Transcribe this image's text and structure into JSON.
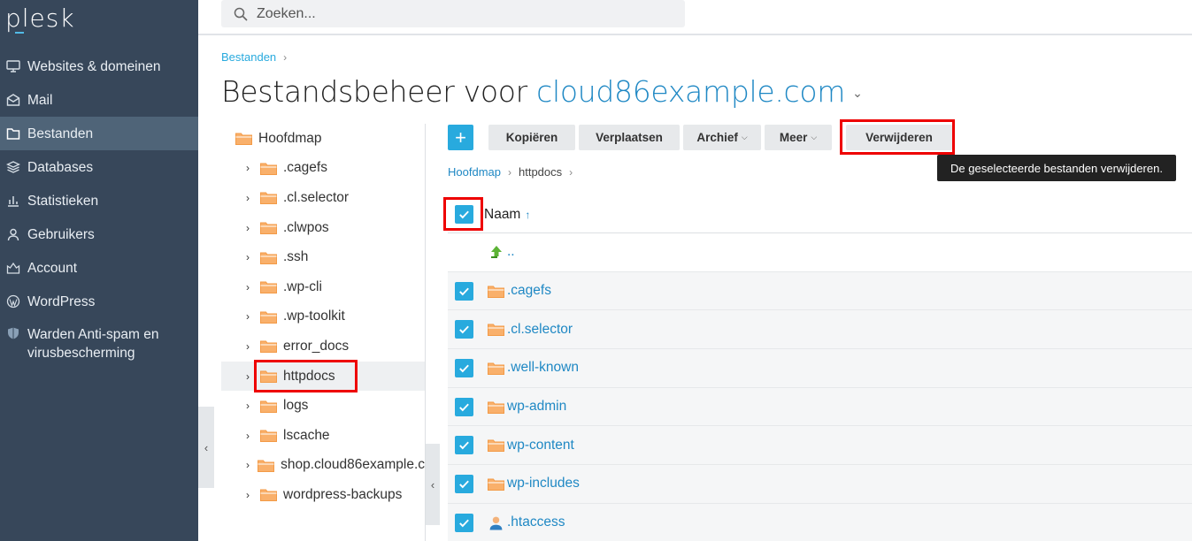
{
  "app": {
    "logo": "plesk"
  },
  "search": {
    "placeholder": "Zoeken..."
  },
  "sidebar": {
    "items": [
      {
        "label": "Websites & domeinen",
        "icon": "monitor-icon"
      },
      {
        "label": "Mail",
        "icon": "mail-icon"
      },
      {
        "label": "Bestanden",
        "icon": "files-icon",
        "active": true
      },
      {
        "label": "Databases",
        "icon": "database-icon"
      },
      {
        "label": "Statistieken",
        "icon": "statistics-icon"
      },
      {
        "label": "Gebruikers",
        "icon": "user-icon"
      },
      {
        "label": "Account",
        "icon": "account-icon"
      },
      {
        "label": "WordPress",
        "icon": "wordpress-icon"
      },
      {
        "label_line1": "Warden Anti-spam en",
        "label_line2": "virusbescherming",
        "icon": "shield-icon"
      }
    ]
  },
  "breadcrumb": {
    "root": "Bestanden"
  },
  "title": {
    "prefix": "Bestandsbeheer voor",
    "domain": "cloud86example.com"
  },
  "tree": {
    "root": "Hoofdmap",
    "children": [
      ".cagefs",
      ".cl.selector",
      ".clwpos",
      ".ssh",
      ".wp-cli",
      ".wp-toolkit",
      "error_docs",
      "httpdocs",
      "logs",
      "lscache",
      "shop.cloud86example.c",
      "wordpress-backups"
    ],
    "selected": "httpdocs"
  },
  "toolbar": {
    "add": "+",
    "copy": "Kopiëren",
    "move": "Verplaatsen",
    "archive": "Archief",
    "more": "Meer",
    "delete": "Verwijderen",
    "delete_tooltip": "De geselecteerde bestanden verwijderen."
  },
  "inner_breadcrumb": {
    "root": "Hoofdmap",
    "current": "httpdocs"
  },
  "table": {
    "header_name": "Naam",
    "sort_indicator": "↑",
    "parent": "..",
    "rows": [
      {
        "name": ".cagefs",
        "type": "folder",
        "checked": true
      },
      {
        "name": ".cl.selector",
        "type": "folder",
        "checked": true
      },
      {
        "name": ".well-known",
        "type": "folder",
        "checked": true
      },
      {
        "name": "wp-admin",
        "type": "folder",
        "checked": true
      },
      {
        "name": "wp-content",
        "type": "folder",
        "checked": true
      },
      {
        "name": "wp-includes",
        "type": "folder",
        "checked": true
      },
      {
        "name": ".htaccess",
        "type": "file-user",
        "checked": true
      }
    ]
  },
  "colors": {
    "sidebar": "#37475a",
    "accent": "#28aade",
    "link": "#1f88c4",
    "highlight": "#ee0000",
    "folder": "#f7a35c"
  }
}
